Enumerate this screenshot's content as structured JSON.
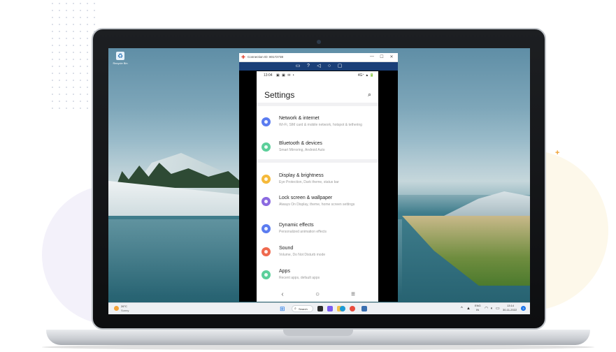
{
  "desktop": {
    "icon_label": "Recycle Bin"
  },
  "window": {
    "title": "Connection ID: 80172738",
    "controls": {
      "minimize": "—",
      "maximize": "☐",
      "close": "✕"
    },
    "toolbar_icons": [
      "screen-icon",
      "help-icon",
      "back-icon",
      "home-icon",
      "recents-icon"
    ]
  },
  "phone": {
    "status": {
      "time": "13:04",
      "right": "4G⁺ ▲ 🔋"
    },
    "title": "Settings",
    "items": [
      {
        "title": "Network & internet",
        "subtitle": "Wi-Fi, SIM card & mobile network, hotspot & tethering",
        "color": "#5b7cf0",
        "icon": "wifi-icon"
      },
      {
        "title": "Bluetooth & devices",
        "subtitle": "Smart Mirroring, Android Auto",
        "color": "#5ccf9a",
        "icon": "bluetooth-icon"
      },
      {
        "title": "Display & brightness",
        "subtitle": "Eye Protection, Dark theme, status bar",
        "color": "#f5b93a",
        "icon": "brightness-icon"
      },
      {
        "title": "Lock screen & wallpaper",
        "subtitle": "Always On Display, theme, home screen settings",
        "color": "#8b6ae0",
        "icon": "wallpaper-icon"
      },
      {
        "title": "Dynamic effects",
        "subtitle": "Personalized animation effects",
        "color": "#5b7cf0",
        "icon": "effects-icon"
      },
      {
        "title": "Sound",
        "subtitle": "Volume, Do Not Disturb mode",
        "color": "#ef6a4f",
        "icon": "sound-icon"
      },
      {
        "title": "Apps",
        "subtitle": "Recent apps, default apps",
        "color": "#5ccf9a",
        "icon": "apps-icon"
      }
    ],
    "nav": {
      "back": "‹",
      "home": "○",
      "menu": "≡"
    }
  },
  "taskbar": {
    "weather_temp": "26°C",
    "weather_cond": "Sunny",
    "search_label": "Search",
    "language": "ENG",
    "region": "IN",
    "time": "13:14",
    "date": "30-11-2022",
    "notification_count": "3"
  }
}
